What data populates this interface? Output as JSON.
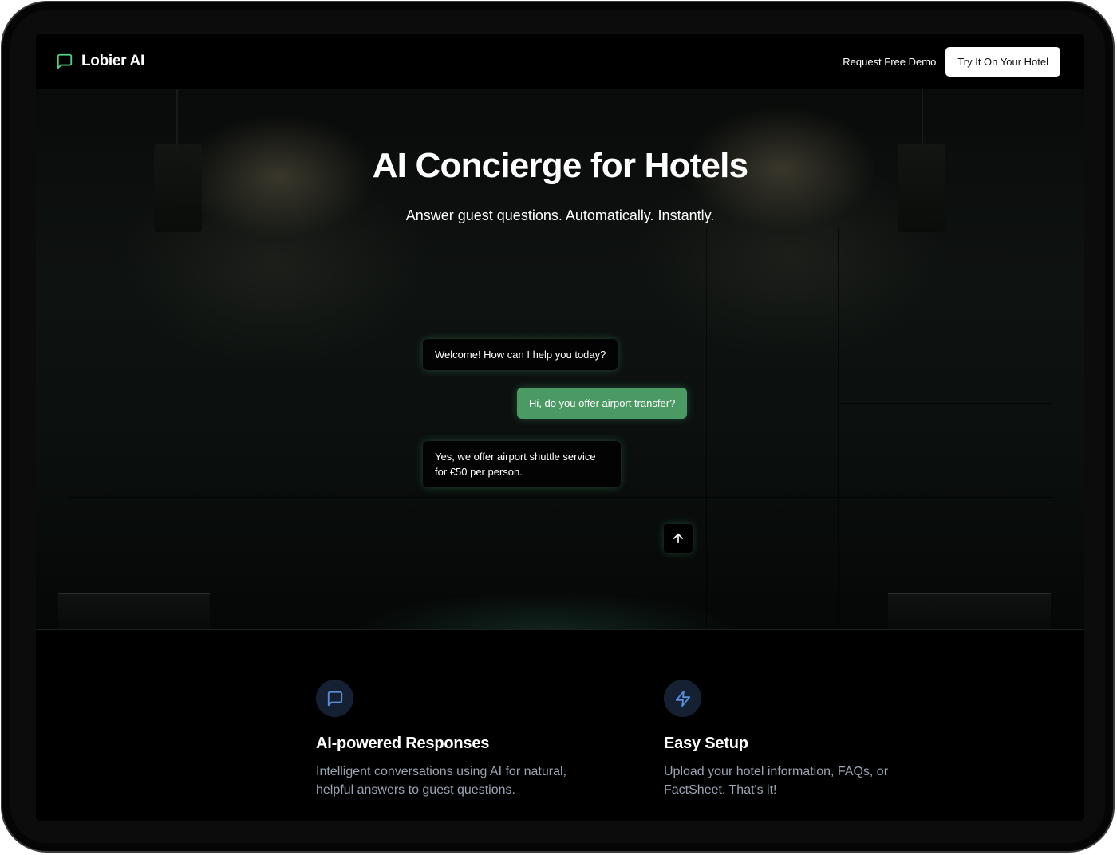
{
  "nav": {
    "brand_name": "Lobier AI",
    "brand_icon": "chat-bubble-icon",
    "brand_icon_color": "#4cd08a",
    "request_demo_label": "Request Free Demo",
    "try_label": "Try It On Your Hotel"
  },
  "hero": {
    "title": "AI Concierge for Hotels",
    "subtitle": "Answer guest questions. Automatically. Instantly.",
    "chat": {
      "bot_message_1": "Welcome! How can I help you today?",
      "user_message_1": "Hi, do you offer airport transfer?",
      "bot_message_2": "Yes, we offer airport shuttle service for €50 per person.",
      "user_bubble_color": "#4b9a63",
      "send_icon": "arrow-up-icon"
    }
  },
  "features": [
    {
      "icon": "message-square-icon",
      "title": "AI-powered Responses",
      "description": "Intelligent conversations using AI for natural, helpful answers to guest questions."
    },
    {
      "icon": "lightning-bolt-icon",
      "title": "Easy Setup",
      "description": "Upload your hotel information, FAQs, or FactSheet. That's it!"
    }
  ],
  "colors": {
    "accent_blue": "#5b8fdc",
    "feature_icon_bg": "#152033",
    "description_text": "#9aa3b2"
  }
}
